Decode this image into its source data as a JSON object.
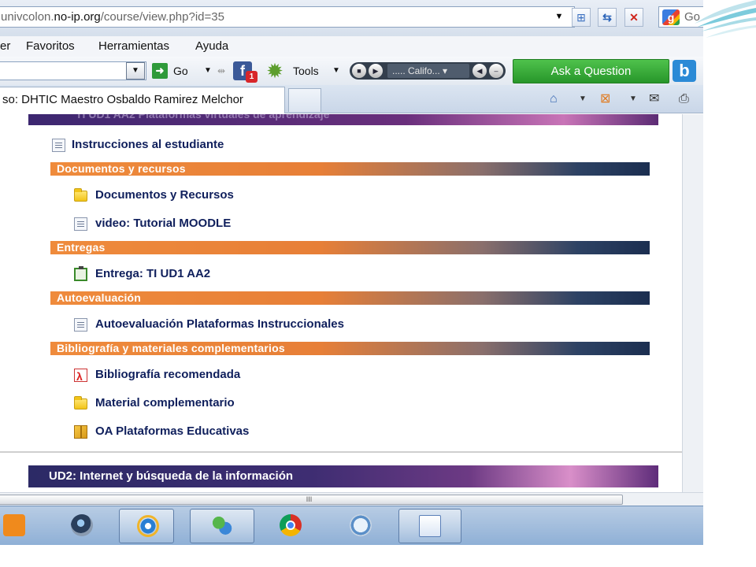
{
  "browser": {
    "address": {
      "prefix": "univcolon.",
      "host": "no-ip.org",
      "path": "/course/view.php?id=35"
    },
    "search_engine_text": "Go",
    "menu": [
      "er",
      "Favoritos",
      "Herramientas",
      "Ayuda"
    ],
    "toolbar": {
      "go_label": "Go",
      "facebook_badge": "1",
      "tools_label": "Tools",
      "media_track": "..... Califo...",
      "ask_label": "Ask a Question"
    },
    "tab": {
      "title": "so: DHTIC Maestro Osbaldo Ramirez Melchor"
    },
    "scroll_grip": "III"
  },
  "course": {
    "unit1_header": "TI UD1 AA2 Plataformas virtuales de aprendizaje",
    "intro_item": "Instrucciones al estudiante",
    "sections": [
      {
        "title": "Documentos y recursos",
        "items": [
          {
            "label": "Documentos y Recursos",
            "icon": "folder-icon"
          },
          {
            "label": "video: Tutorial MOODLE",
            "icon": "document-icon"
          }
        ]
      },
      {
        "title": "Entregas",
        "items": [
          {
            "label": "Entrega: TI UD1 AA2",
            "icon": "assignment-icon"
          }
        ]
      },
      {
        "title": "Autoevaluación",
        "items": [
          {
            "label": "Autoevaluación Plataformas Instruccionales",
            "icon": "document-icon"
          }
        ]
      },
      {
        "title": "Bibliografía y materiales complementarios",
        "items": [
          {
            "label": "Bibliografía recomendada",
            "icon": "pdf-icon"
          },
          {
            "label": "Material complementario",
            "icon": "folder-icon"
          },
          {
            "label": "OA Plataformas Educativas",
            "icon": "package-icon"
          }
        ]
      }
    ],
    "unit2_header": "UD2: Internet y búsqueda de la información"
  },
  "colors": {
    "section_orange": "#ef8b3c",
    "section_navy": "#1b2e50",
    "unit_purple": "#3e2d72",
    "link_text": "#0f1f5c",
    "ask_green": "#27962a"
  }
}
